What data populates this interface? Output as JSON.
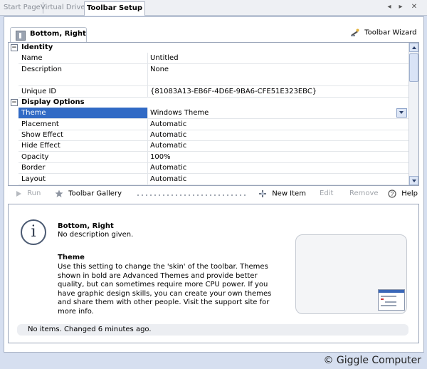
{
  "tabs": [
    {
      "label": "Start Page",
      "active": false
    },
    {
      "label": "Virtual Drives",
      "active": false
    },
    {
      "label": "Toolbar Setup",
      "active": true
    }
  ],
  "tab_controls": {
    "prev": "◂",
    "next": "▸",
    "close": "✕"
  },
  "panel": {
    "tab_label": "Bottom, Right",
    "wizard_label": "Toolbar Wizard"
  },
  "properties": {
    "identity": {
      "title": "Identity",
      "toggle": "−",
      "rows": [
        {
          "name": "Name",
          "value": "Untitled"
        },
        {
          "name": "Description",
          "value": "None"
        },
        {
          "name": "Unique ID",
          "value": "{81083A13-EB6F-4D6E-9BA6-CFE51E323EBC}"
        }
      ]
    },
    "display": {
      "title": "Display Options",
      "toggle": "−",
      "rows": [
        {
          "name": "Theme",
          "value": "Windows Theme",
          "selected": true
        },
        {
          "name": "Placement",
          "value": "Automatic"
        },
        {
          "name": "Show Effect",
          "value": "Automatic"
        },
        {
          "name": "Hide Effect",
          "value": "Automatic"
        },
        {
          "name": "Opacity",
          "value": "100%"
        },
        {
          "name": "Border",
          "value": "Automatic"
        },
        {
          "name": "Layout",
          "value": "Automatic"
        }
      ]
    }
  },
  "toolbar": {
    "run": "Run",
    "gallery": "Toolbar Gallery",
    "new_item": "New Item",
    "edit": "Edit",
    "remove": "Remove",
    "help": "Help"
  },
  "info": {
    "icon_glyph": "i",
    "title": "Bottom, Right",
    "description": "No description given.",
    "topic_title": "Theme",
    "topic_text": "Use this setting to change the 'skin' of the toolbar. Themes shown in bold are Advanced Themes and provide better quality, but can sometimes require more CPU power. If you have graphic design skills, you can create your own themes and share them with other people. Visit the support site for more info.",
    "status": "No items. Changed 6 minutes ago."
  },
  "watermark": "© Giggle Computer"
}
